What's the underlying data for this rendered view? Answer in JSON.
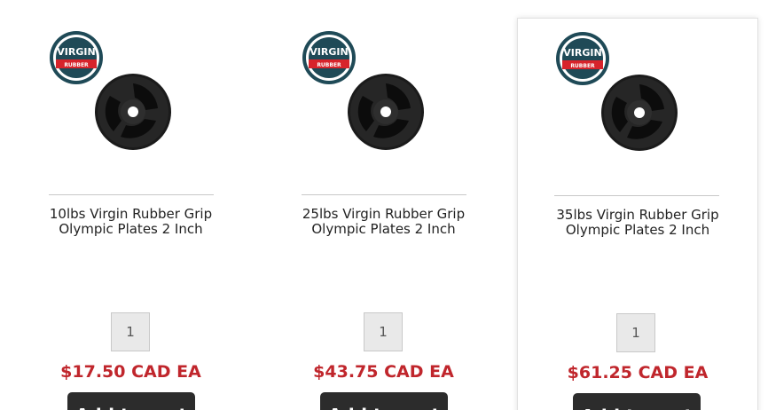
{
  "products": [
    {
      "title_line1": "10lbs Virgin Rubber Grip",
      "title_line2": "Olympic Plates 2 Inch",
      "quantity": "1",
      "price": "$17.50 CAD EA",
      "button_label": "Add to cart",
      "badge_top": "VIRGIN",
      "badge_bottom": "RUBBER"
    },
    {
      "title_line1": "25lbs Virgin Rubber Grip",
      "title_line2": "Olympic Plates 2 Inch",
      "quantity": "1",
      "price": "$43.75 CAD EA",
      "button_label": "Add to cart",
      "badge_top": "VIRGIN",
      "badge_bottom": "RUBBER"
    },
    {
      "title_line1": "35lbs Virgin Rubber Grip",
      "title_line2": "Olympic Plates 2 Inch",
      "quantity": "1",
      "price": "$61.25 CAD EA",
      "button_label": "Add to cart",
      "badge_top": "VIRGIN",
      "badge_bottom": "RUBBER"
    }
  ],
  "colors": {
    "price": "#c0262c",
    "button": "#2c2c2c",
    "badge_ring": "#1f4a57",
    "badge_band": "#d7232b"
  },
  "icons": {
    "badge": "virgin-rubber-badge-icon",
    "plate": "weight-plate-icon"
  }
}
